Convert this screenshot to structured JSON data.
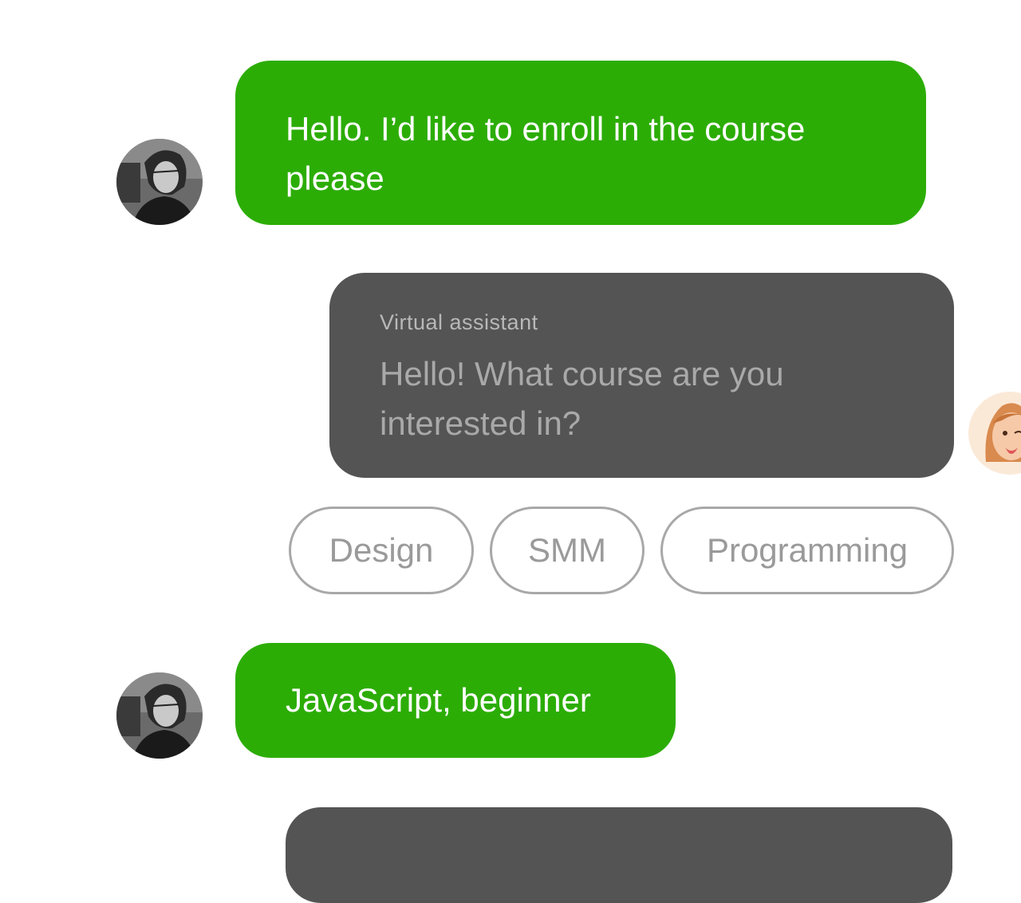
{
  "messages": [
    {
      "role": "user",
      "text": "Hello. I’d like to enroll in the course please"
    },
    {
      "role": "assistant",
      "sender": "Virtual assistant",
      "text": "Hello! What course are you interested in?"
    },
    {
      "role": "user",
      "text": "JavaScript, beginner"
    }
  ],
  "quick_replies": [
    "Design",
    "SMM",
    "Programming"
  ],
  "colors": {
    "user_bubble": "#2cad06",
    "assistant_bubble": "#545454",
    "chip_border": "#a8a8a8",
    "background": "#ffffff"
  },
  "icons": {
    "user_avatar": "user-photo-avatar",
    "assistant_avatar": "assistant-memoji-avatar"
  }
}
